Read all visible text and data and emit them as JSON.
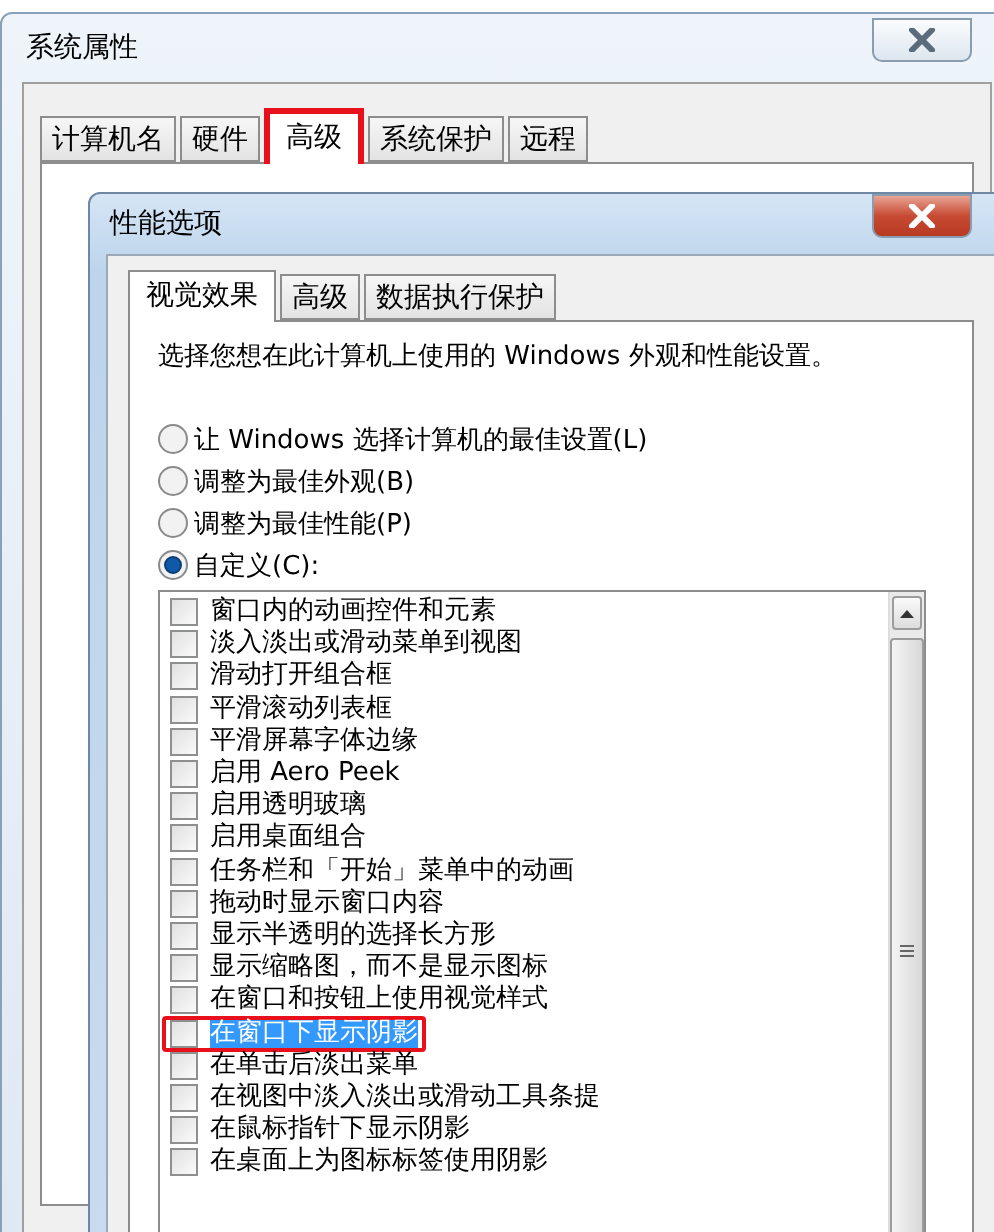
{
  "outer_window": {
    "title": "系统属性",
    "tabs": [
      {
        "label": "计算机名",
        "selected": false,
        "annotated": false
      },
      {
        "label": "硬件",
        "selected": false,
        "annotated": false
      },
      {
        "label": "高级",
        "selected": true,
        "annotated": true
      },
      {
        "label": "系统保护",
        "selected": false,
        "annotated": false
      },
      {
        "label": "远程",
        "selected": false,
        "annotated": false
      }
    ]
  },
  "dialog": {
    "title": "性能选项",
    "tabs": [
      {
        "label": "视觉效果",
        "selected": true
      },
      {
        "label": "高级",
        "selected": false
      },
      {
        "label": "数据执行保护",
        "selected": false
      }
    ],
    "description": "选择您想在此计算机上使用的 Windows 外观和性能设置。",
    "options": [
      {
        "label": "让 Windows 选择计算机的最佳设置(L)",
        "selected": false
      },
      {
        "label": "调整为最佳外观(B)",
        "selected": false
      },
      {
        "label": "调整为最佳性能(P)",
        "selected": false
      },
      {
        "label": "自定义(C):",
        "selected": true
      }
    ],
    "effects": [
      {
        "label": "窗口内的动画控件和元素",
        "checked": false,
        "selected": false,
        "annotated": false
      },
      {
        "label": "淡入淡出或滑动菜单到视图",
        "checked": false,
        "selected": false,
        "annotated": false
      },
      {
        "label": "滑动打开组合框",
        "checked": false,
        "selected": false,
        "annotated": false
      },
      {
        "label": "平滑滚动列表框",
        "checked": false,
        "selected": false,
        "annotated": false
      },
      {
        "label": "平滑屏幕字体边缘",
        "checked": false,
        "selected": false,
        "annotated": false
      },
      {
        "label": "启用 Aero Peek",
        "checked": false,
        "selected": false,
        "annotated": false
      },
      {
        "label": "启用透明玻璃",
        "checked": false,
        "selected": false,
        "annotated": false
      },
      {
        "label": "启用桌面组合",
        "checked": false,
        "selected": false,
        "annotated": false
      },
      {
        "label": "任务栏和「开始」菜单中的动画",
        "checked": false,
        "selected": false,
        "annotated": false
      },
      {
        "label": "拖动时显示窗口内容",
        "checked": false,
        "selected": false,
        "annotated": false
      },
      {
        "label": "显示半透明的选择长方形",
        "checked": false,
        "selected": false,
        "annotated": false
      },
      {
        "label": "显示缩略图，而不是显示图标",
        "checked": false,
        "selected": false,
        "annotated": false
      },
      {
        "label": "在窗口和按钮上使用视觉样式",
        "checked": false,
        "selected": false,
        "annotated": false
      },
      {
        "label": "在窗口下显示阴影",
        "checked": false,
        "selected": true,
        "annotated": true
      },
      {
        "label": "在单击后淡出菜单",
        "checked": false,
        "selected": false,
        "annotated": false
      },
      {
        "label": "在视图中淡入淡出或滑动工具条提",
        "checked": false,
        "selected": false,
        "annotated": false
      },
      {
        "label": "在鼠标指针下显示阴影",
        "checked": false,
        "selected": false,
        "annotated": false
      },
      {
        "label": "在桌面上为图标标签使用阴影",
        "checked": false,
        "selected": false,
        "annotated": false
      }
    ]
  }
}
